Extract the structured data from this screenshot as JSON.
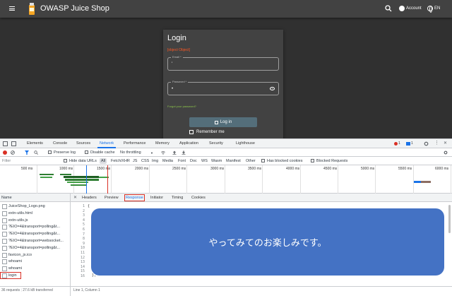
{
  "app": {
    "title": "OWASP Juice Shop",
    "account_label": "Account",
    "language": "EN"
  },
  "login": {
    "title": "Login",
    "error": "[object Object]",
    "email_label": "Email *",
    "email_value": "'",
    "password_label": "Password *",
    "password_value": "•",
    "forgot": "Forgot your password?",
    "button": "Log in",
    "remember": "Remember me"
  },
  "devtools": {
    "tabs": [
      "Elements",
      "Console",
      "Sources",
      "Network",
      "Performance",
      "Memory",
      "Application",
      "Security",
      "Lighthouse"
    ],
    "active_tab": "Network",
    "error_count": "1",
    "message_count": "1",
    "toolbar": {
      "preserve_log": "Preserve log",
      "disable_cache": "Disable cache",
      "throttling": "No throttling"
    },
    "filter": {
      "placeholder": "Filter",
      "hide_data_urls": "Hide data URLs",
      "types": [
        "All",
        "Fetch/XHR",
        "JS",
        "CSS",
        "Img",
        "Media",
        "Font",
        "Doc",
        "WS",
        "Wasm",
        "Manifest",
        "Other"
      ],
      "blocked_cookies": "Has blocked cookies",
      "blocked_requests": "Blocked Requests"
    },
    "overview_ticks": [
      "500 ms",
      "1000 ms",
      "1500 ms",
      "2000 ms",
      "2500 ms",
      "3000 ms",
      "3500 ms",
      "4000 ms",
      "4500 ms",
      "5000 ms",
      "5500 ms",
      "6000 ms"
    ],
    "requests": {
      "header": "Name",
      "items": [
        "JuiceShop_Logo.png",
        "extn-utils.html",
        "extn-utils.js",
        "?EIO=4&transport=polling&t...",
        "?EIO=4&transport=polling&t...",
        "?EIO=4&transport=websocket...",
        "?EIO=4&transport=polling&t...",
        "favicon_js.ico",
        "whoami",
        "whoami",
        "login"
      ],
      "selected": "login",
      "summary_requests": "36 requests",
      "summary_transferred": "27.6 kB transferred"
    },
    "detail": {
      "tabs": [
        "Headers",
        "Preview",
        "Response",
        "Initiator",
        "Timing",
        "Cookies"
      ],
      "active_tab": "Response",
      "line_numbers": [
        "1",
        "2",
        "3",
        "4",
        "5",
        "6",
        "7",
        "8",
        "9",
        "10",
        "11",
        "12",
        "13",
        "14",
        "15",
        "16"
      ],
      "first_char": "{",
      "last_char": "},",
      "status": "Line 1, Column 1"
    }
  },
  "overlay": {
    "text": "やってみてのお楽しみです。"
  },
  "colors": {
    "app_bg": "#303030",
    "app_bar": "#424242",
    "accent": "#1a73e8",
    "error": "#d93025",
    "overlay": "#4472c4"
  }
}
